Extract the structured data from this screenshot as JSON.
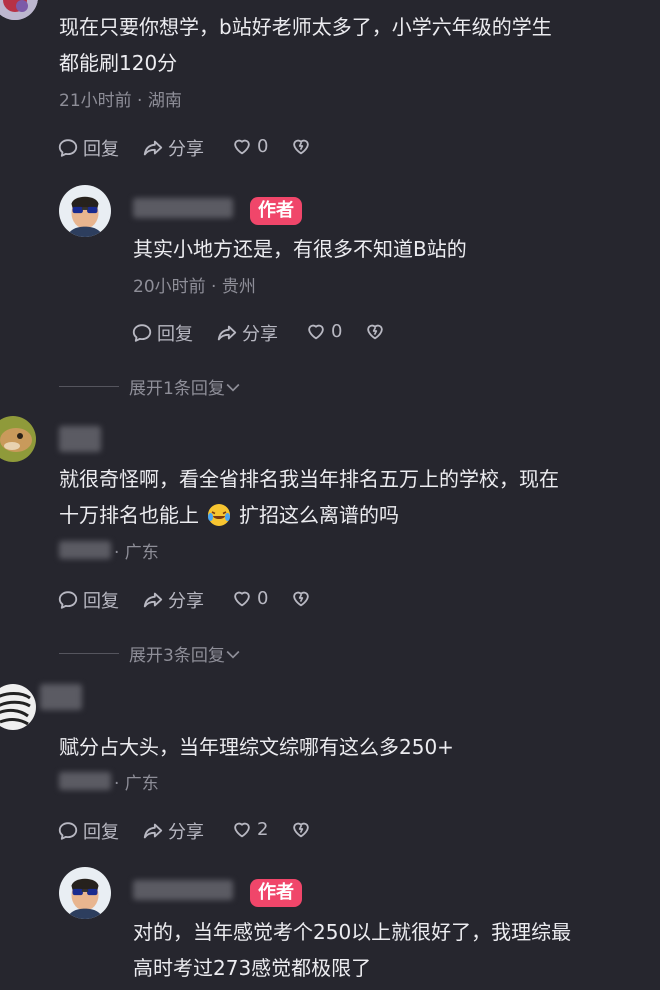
{
  "labels": {
    "reply": "回复",
    "share": "分享",
    "author_tag": "作者"
  },
  "comments": [
    {
      "text_lines": [
        "现在只要你想学，b站好老师太多了，小学六年级的学生",
        "都能刷120分"
      ],
      "meta": "21小时前 · 湖南",
      "likes": "0",
      "replies": [
        {
          "text_lines": [
            "其实小地方还是，有很多不知道B站的"
          ],
          "meta": "20小时前 · 贵州",
          "likes": "0"
        }
      ],
      "expand": "展开1条回复"
    },
    {
      "text_lines": [
        "就很奇怪啊，看全省排名我当年排名五万上的学校，现在",
        "十万排名也能上",
        "扩招这么离谱的吗"
      ],
      "meta": "· 广东",
      "likes": "0",
      "expand": "展开3条回复"
    },
    {
      "text_lines": [
        "赋分占大头，当年理综文综哪有这么多250+"
      ],
      "meta": "· 广东",
      "likes": "2",
      "replies": [
        {
          "text_lines": [
            "对的，当年感觉考个250以上就很好了，我理综最",
            "高时考过273感觉都极限了"
          ]
        }
      ]
    }
  ],
  "colors": {
    "background": "#26262e",
    "author_tag": "#f0466a",
    "muted": "#8e8e98"
  },
  "icons": [
    "comment-reply-icon",
    "share-arrow-icon",
    "heart-icon",
    "dislike-heart-icon",
    "chevron-down-icon",
    "laughing-crying-emoji"
  ]
}
